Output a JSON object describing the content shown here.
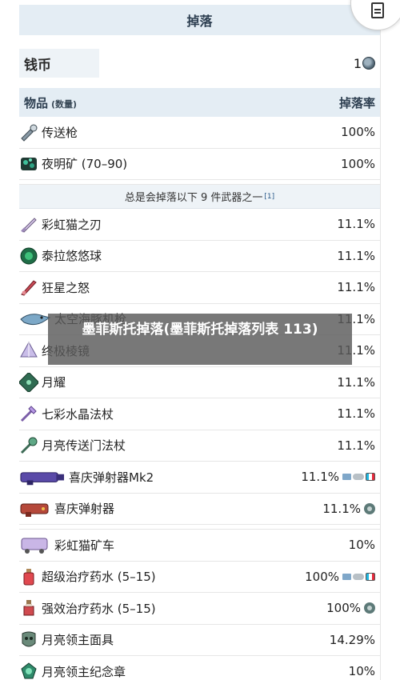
{
  "header": {
    "title": "掉落"
  },
  "coins": {
    "label": "钱币",
    "value": "1"
  },
  "columns": {
    "item": "物品",
    "qty": "(数量)",
    "rate": "掉落率"
  },
  "guaranteed": [
    {
      "name": "传送枪",
      "rate": "100%",
      "icon": "portal-gun-icon"
    },
    {
      "name": "夜明矿 (70–90)",
      "rate": "100%",
      "icon": "luminite-ore-icon"
    }
  ],
  "weapon_group": {
    "label": "总是会掉落以下 9 件武器之一",
    "ref": "[1]"
  },
  "weapons": [
    {
      "name": "彩虹猫之刃",
      "rate": "11.1%",
      "icon": "meowmere-icon"
    },
    {
      "name": "泰拉悠悠球",
      "rate": "11.1%",
      "icon": "terrarian-yoyo-icon"
    },
    {
      "name": "狂星之怒",
      "rate": "11.1%",
      "icon": "star-wrath-icon"
    },
    {
      "name": "太空海豚机枪",
      "rate": "11.1%",
      "icon": "sdmg-icon"
    },
    {
      "name": "终极棱镜",
      "rate": "11.1%",
      "icon": "last-prism-icon"
    },
    {
      "name": "月耀",
      "rate": "11.1%",
      "icon": "lunar-flare-icon"
    },
    {
      "name": "七彩水晶法杖",
      "rate": "11.1%",
      "icon": "rainbow-crystal-staff-icon"
    },
    {
      "name": "月亮传送门法杖",
      "rate": "11.1%",
      "icon": "lunar-portal-staff-icon"
    },
    {
      "name": "喜庆弹射器Mk2",
      "rate": "11.1%",
      "icon": "celebration-mk2-icon",
      "platforms": true
    },
    {
      "name": "喜庆弹射器",
      "rate": "11.1%",
      "icon": "celebration-icon",
      "gear": true
    }
  ],
  "other": [
    {
      "name": "彩虹猫矿车",
      "rate": "10%",
      "icon": "meowmere-minecart-icon"
    },
    {
      "name": "超级治疗药水 (5–15)",
      "rate": "100%",
      "icon": "super-healing-potion-icon",
      "platforms": true
    },
    {
      "name": "强效治疗药水 (5–15)",
      "rate": "100%",
      "icon": "greater-healing-potion-icon",
      "gear": true
    },
    {
      "name": "月亮领主面具",
      "rate": "14.29%",
      "icon": "moon-lord-mask-icon"
    },
    {
      "name": "月亮领主纪念章",
      "rate": "10%",
      "icon": "moon-lord-relic-icon"
    }
  ],
  "overlay": {
    "text": "墨菲斯托掉落(墨菲斯托掉落列表 113)"
  }
}
